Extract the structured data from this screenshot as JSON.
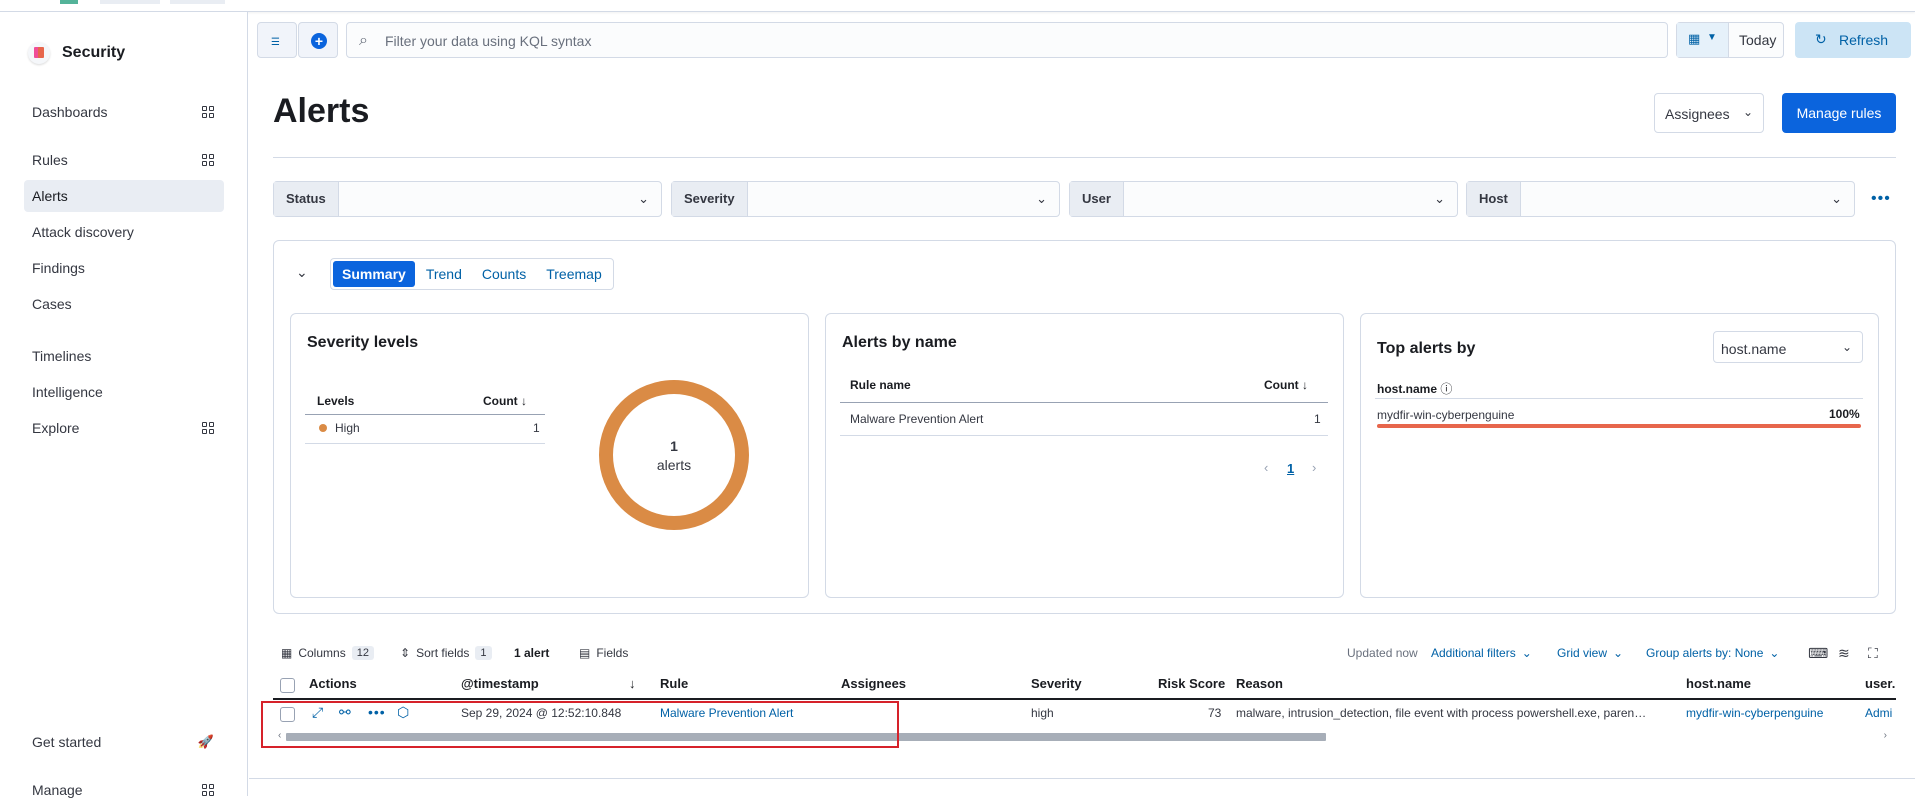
{
  "app": {
    "name": "Security"
  },
  "sidebar": {
    "items": [
      {
        "label": "Dashboards"
      },
      {
        "label": "Rules"
      },
      {
        "label": "Alerts"
      },
      {
        "label": "Attack discovery"
      },
      {
        "label": "Findings"
      },
      {
        "label": "Cases"
      },
      {
        "label": "Timelines"
      },
      {
        "label": "Intelligence"
      },
      {
        "label": "Explore"
      },
      {
        "label": "Get started"
      },
      {
        "label": "Manage"
      }
    ]
  },
  "querybar": {
    "placeholder": "Filter your data using KQL syntax",
    "date_label": "Today",
    "refresh_label": "Refresh"
  },
  "header": {
    "title": "Alerts",
    "assignees_label": "Assignees",
    "manage_rules_label": "Manage rules"
  },
  "filters": [
    {
      "label": "Status"
    },
    {
      "label": "Severity"
    },
    {
      "label": "User"
    },
    {
      "label": "Host"
    }
  ],
  "summary": {
    "tabs": [
      "Summary",
      "Trend",
      "Counts",
      "Treemap"
    ],
    "severity": {
      "title": "Severity levels",
      "col_levels": "Levels",
      "col_count": "Count",
      "rows": [
        {
          "level": "High",
          "count": "1"
        }
      ],
      "donut_count": "1",
      "donut_label": "alerts",
      "colors": {
        "high": "#da8b45"
      }
    },
    "by_name": {
      "title": "Alerts by name",
      "col_rule": "Rule name",
      "col_count": "Count",
      "rows": [
        {
          "rule": "Malware Prevention Alert",
          "count": "1"
        }
      ],
      "page": "1"
    },
    "top_alerts": {
      "title": "Top alerts by",
      "field_select": "host.name",
      "col_field": "host.name",
      "rows": [
        {
          "host": "mydfir-win-cyberpenguine",
          "pct": "100%",
          "share": 1.0
        }
      ]
    }
  },
  "table_toolbar": {
    "columns_label": "Columns",
    "columns_count": "12",
    "sort_label": "Sort fields",
    "sort_count": "1",
    "alert_count": "1 alert",
    "fields_label": "Fields",
    "updated": "Updated now",
    "additional_filters": "Additional filters",
    "grid_view": "Grid view",
    "group_by": "Group alerts by: None"
  },
  "grid": {
    "headers": {
      "actions": "Actions",
      "timestamp": "@timestamp",
      "rule": "Rule",
      "assignees": "Assignees",
      "severity": "Severity",
      "risk": "Risk Score",
      "reason": "Reason",
      "host": "host.name",
      "user": "user."
    },
    "rows": [
      {
        "timestamp": "Sep 29, 2024 @ 12:52:10.848",
        "rule": "Malware Prevention Alert",
        "assignees": "",
        "severity": "high",
        "risk": "73",
        "reason": "malware, intrusion_detection, file event with process powershell.exe, paren…",
        "host": "mydfir-win-cyberpenguine",
        "user": "Admi"
      }
    ]
  },
  "colors": {
    "accent": "#0b64dd",
    "highlight_box": "#d6222a",
    "bar": "#e7664c"
  }
}
